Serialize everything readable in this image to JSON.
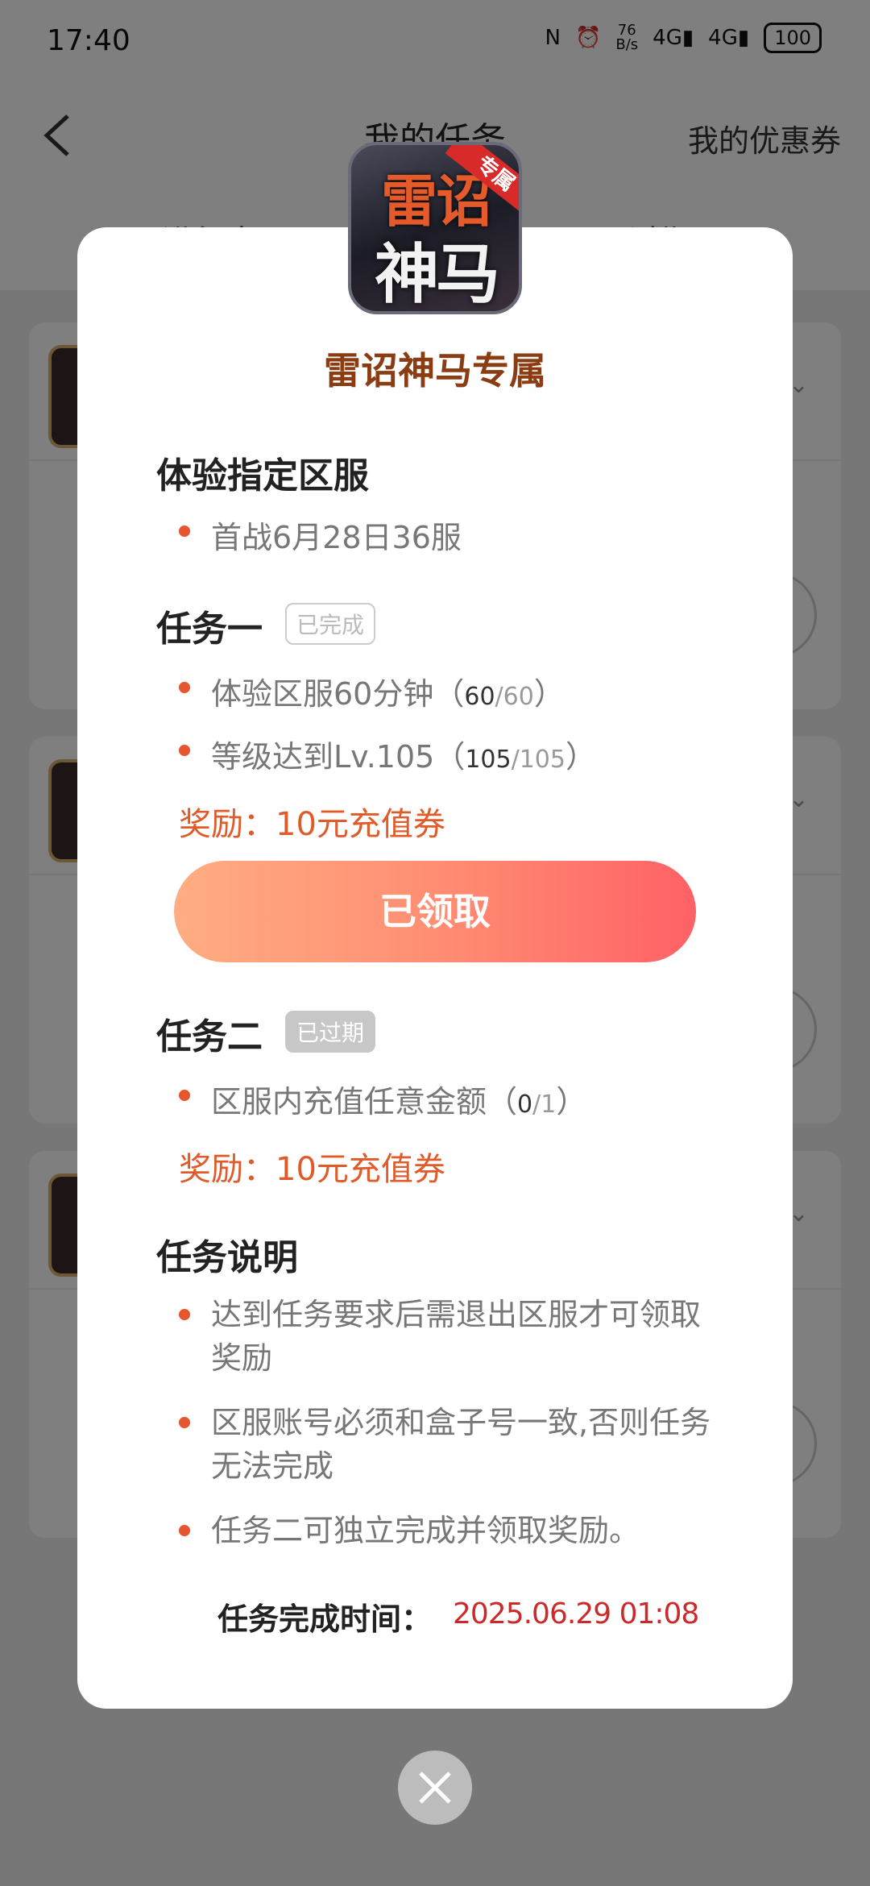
{
  "status_bar": {
    "time": "17:40",
    "net_speed_value": "76",
    "net_speed_unit": "B/s",
    "signal_1": "4G",
    "signal_2": "4G",
    "battery": "100"
  },
  "header": {
    "title": "我的任务",
    "right_link": "我的优惠券"
  },
  "tabs": [
    "进行中",
    "已过期"
  ],
  "dialog": {
    "game_icon_text_top": "雷诏",
    "game_icon_text_bottom": "神马",
    "game_icon_ribbon": "专属",
    "title": "雷诏神马专属",
    "server_section": {
      "title": "体验指定区服",
      "item": "首战6月28日36服"
    },
    "task_one": {
      "title": "任务一",
      "badge": "已完成",
      "items": [
        {
          "text": "体验区服60分钟（",
          "num": "60",
          "den": "/60",
          "close": "）"
        },
        {
          "text": "等级达到Lv.105（",
          "num": "105",
          "den": "/105",
          "close": "）"
        }
      ],
      "reward": "奖励：10元充值券",
      "button": "已领取"
    },
    "task_two": {
      "title": "任务二",
      "badge": "已过期",
      "item": {
        "text": "区服内充值任意金额（",
        "num": "0",
        "den": "/1",
        "close": "）"
      },
      "reward": "奖励：10元充值券"
    },
    "notes": {
      "title": "任务说明",
      "items": [
        "达到任务要求后需退出区服才可领取奖励",
        "区服账号必须和盒子号一致,否则任务无法完成",
        "任务二可独立完成并领取奖励。"
      ]
    },
    "finish_label": "任务完成时间：",
    "finish_time": "2025.06.29 01:08"
  },
  "colors": {
    "accent": "#e05a2a",
    "title_brown": "#8a3d12",
    "finish_red": "#cc2a2a"
  }
}
